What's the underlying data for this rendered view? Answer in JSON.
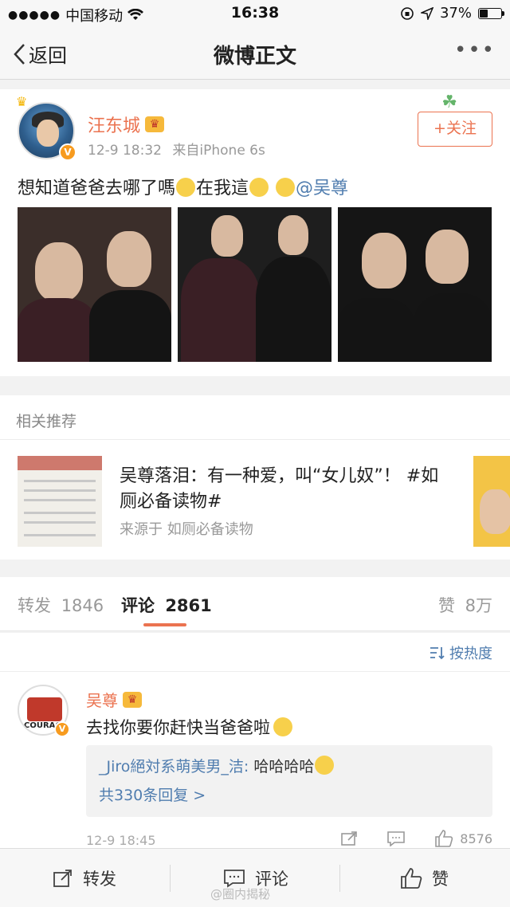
{
  "status_bar": {
    "carrier": "中国移动",
    "time": "16:38",
    "battery_percent": "37%",
    "battery_level": 0.37
  },
  "nav": {
    "back_label": "返回",
    "title": "微博正文"
  },
  "post": {
    "author": "汪东城",
    "time": "12-9 18:32",
    "source": "来自iPhone 6s",
    "follow_label": "+关注",
    "text_part1": "想知道爸爸去哪了嗎",
    "text_part2": "在我這",
    "mention": "@吴尊"
  },
  "related": {
    "header": "相关推荐",
    "title": "吴尊落泪：有一种爱，叫“女儿奴”！ #如厕必备读物#",
    "source": "来源于 如厕必备读物"
  },
  "tabs": {
    "repost_label": "转发",
    "repost_count": "1846",
    "comment_label": "评论",
    "comment_count": "2861",
    "like_label": "赞",
    "like_count": "8万"
  },
  "sort": {
    "label": "按热度"
  },
  "comment": {
    "author": "吴尊",
    "text": "去找你要你赶快当爸爸啦",
    "reply_author": "_Jiro絕対系萌美男_洁:",
    "reply_text": "哈哈哈哈",
    "reply_more": "共330条回复 >",
    "time": "12-9 18:45",
    "like_count": "8576",
    "avatar_text": "COURAG"
  },
  "bottom_bar": {
    "repost": "转发",
    "comment": "评论",
    "like": "赞",
    "watermark": "@圈内揭秘"
  },
  "colors": {
    "accent": "#eb7350",
    "link": "#507daf"
  }
}
